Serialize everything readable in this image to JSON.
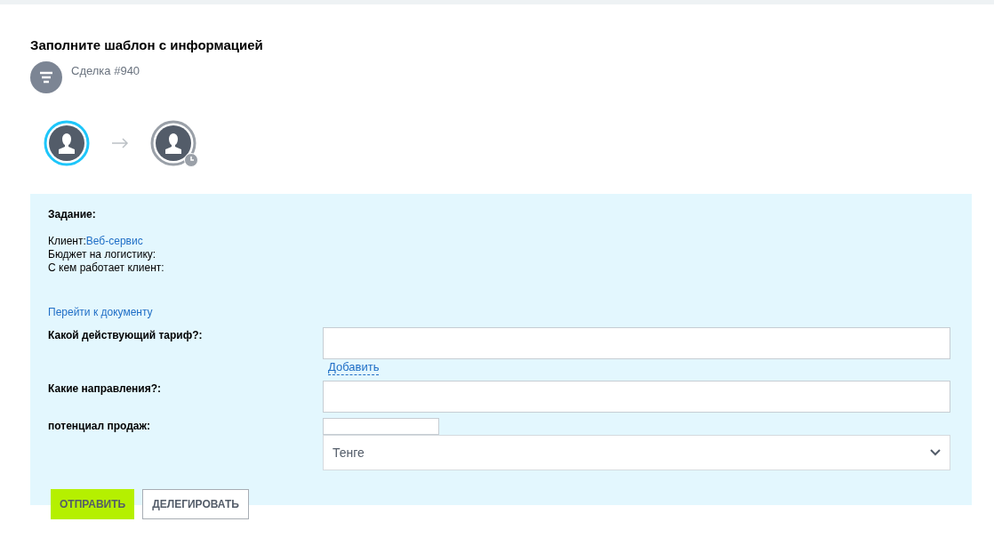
{
  "title": "Заполните шаблон с информацией",
  "entity": {
    "label": "Сделка #940"
  },
  "participants": [
    {
      "kind": "active"
    },
    {
      "kind": "pending"
    }
  ],
  "task": {
    "heading": "Задание:",
    "lines": [
      {
        "label": "Клиент:",
        "link": "Веб-сервис"
      },
      {
        "label": "Бюджет на логистику:"
      },
      {
        "label": "С кем работает клиент:"
      }
    ],
    "document_link": "Перейти к документу"
  },
  "fields": [
    {
      "kind": "text",
      "label": "Какой действующий тариф?:",
      "add_link": "Добавить"
    },
    {
      "kind": "text",
      "label": "Какие направления?:"
    },
    {
      "kind": "money",
      "label": "потенциал продаж:",
      "currency": "Тенге"
    }
  ],
  "buttons": [
    {
      "label": "ОТПРАВИТЬ",
      "kind": "primary"
    },
    {
      "label": "ДЕЛЕГИРОВАТЬ",
      "kind": "secondary"
    }
  ]
}
